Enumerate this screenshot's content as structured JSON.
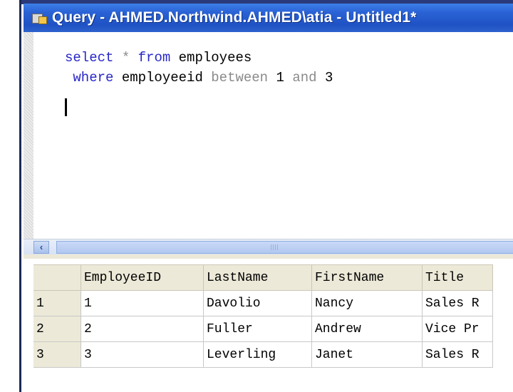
{
  "window": {
    "title": "Query - AHMED.Northwind.AHMED\\atia - Untitled1*"
  },
  "editor": {
    "line1": {
      "kw1": "select",
      "op": "*",
      "kw2": "from",
      "rest": "employees"
    },
    "line2": {
      "kw1": "where",
      "col": "employeeid",
      "op1": "between",
      "v1": "1",
      "op2": "and",
      "v2": "3"
    }
  },
  "results": {
    "columns": [
      "EmployeeID",
      "LastName",
      "FirstName",
      "Title"
    ],
    "rows": [
      {
        "num": "1",
        "cells": [
          "1",
          "Davolio",
          "Nancy",
          "Sales R"
        ]
      },
      {
        "num": "2",
        "cells": [
          "2",
          "Fuller",
          "Andrew",
          "Vice Pr"
        ]
      },
      {
        "num": "3",
        "cells": [
          "3",
          "Leverling",
          "Janet",
          "Sales R"
        ]
      }
    ]
  },
  "colors": {
    "keyword": "#2727c8",
    "operator": "#8a8a8a",
    "titlebar": "#2a63d6"
  },
  "icons": [
    "query-window-icon",
    "scroll-left-arrow-icon"
  ]
}
